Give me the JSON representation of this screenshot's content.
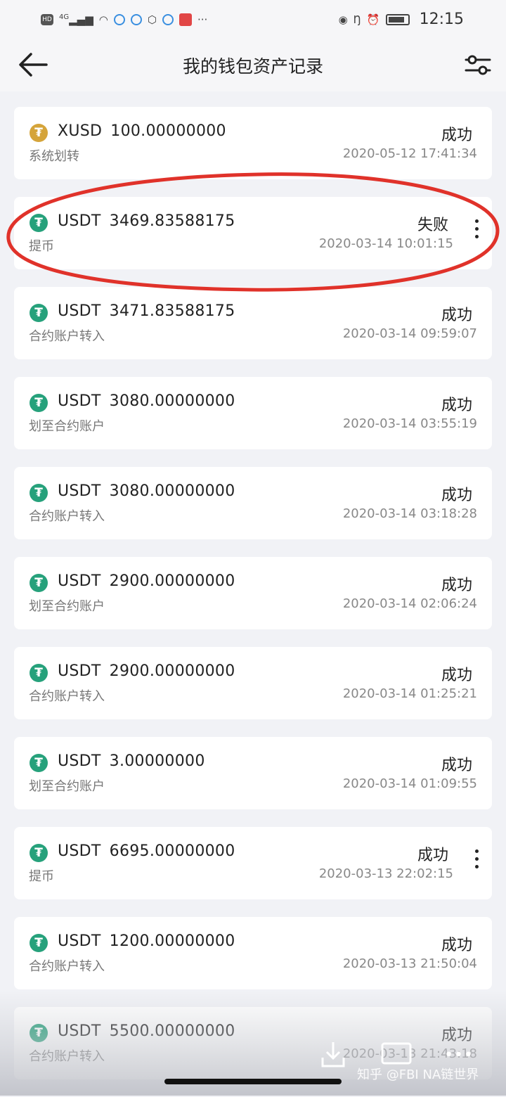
{
  "status_bar": {
    "net_badge": "HD",
    "signal_text": "4G",
    "time": "12:15"
  },
  "header": {
    "title": "我的钱包资产记录",
    "back_icon": "arrow-left-icon",
    "filter_icon": "sliders-icon"
  },
  "records": [
    {
      "coin_icon": "xusd-coin-icon",
      "currency": "XUSD",
      "amount": "100.00000000",
      "type": "系统划转",
      "status": "成功",
      "datetime": "2020-05-12 17:41:34"
    },
    {
      "coin_icon": "tether-coin-icon",
      "currency": "USDT",
      "amount": "3469.83588175",
      "type": "提币",
      "status": "失败",
      "datetime": "2020-03-14 10:01:15"
    },
    {
      "coin_icon": "tether-coin-icon",
      "currency": "USDT",
      "amount": "3471.83588175",
      "type": "合约账户转入",
      "status": "成功",
      "datetime": "2020-03-14 09:59:07"
    },
    {
      "coin_icon": "tether-coin-icon",
      "currency": "USDT",
      "amount": "3080.00000000",
      "type": "划至合约账户",
      "status": "成功",
      "datetime": "2020-03-14 03:55:19"
    },
    {
      "coin_icon": "tether-coin-icon",
      "currency": "USDT",
      "amount": "3080.00000000",
      "type": "合约账户转入",
      "status": "成功",
      "datetime": "2020-03-14 03:18:28"
    },
    {
      "coin_icon": "tether-coin-icon",
      "currency": "USDT",
      "amount": "2900.00000000",
      "type": "划至合约账户",
      "status": "成功",
      "datetime": "2020-03-14 02:06:24"
    },
    {
      "coin_icon": "tether-coin-icon",
      "currency": "USDT",
      "amount": "2900.00000000",
      "type": "合约账户转入",
      "status": "成功",
      "datetime": "2020-03-14 01:25:21"
    },
    {
      "coin_icon": "tether-coin-icon",
      "currency": "USDT",
      "amount": "3.00000000",
      "type": "划至合约账户",
      "status": "成功",
      "datetime": "2020-03-14 01:09:55"
    },
    {
      "coin_icon": "tether-coin-icon",
      "currency": "USDT",
      "amount": "6695.00000000",
      "type": "提币",
      "status": "成功",
      "datetime": "2020-03-13 22:02:15"
    },
    {
      "coin_icon": "tether-coin-icon",
      "currency": "USDT",
      "amount": "1200.00000000",
      "type": "合约账户转入",
      "status": "成功",
      "datetime": "2020-03-13 21:50:04"
    },
    {
      "coin_icon": "tether-coin-icon",
      "currency": "USDT",
      "amount": "5500.00000000",
      "type": "合约账户转入",
      "status": "成功",
      "datetime": "2020-03-13 21:43:18"
    }
  ],
  "overlay": {
    "watermark": "知乎 @FBI NA链世界",
    "annotation_color": "#e0322a"
  }
}
